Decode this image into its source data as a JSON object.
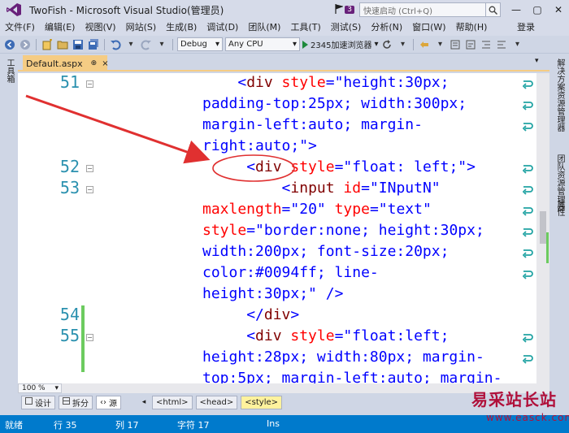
{
  "window": {
    "title": "TwoFish - Microsoft Visual Studio(管理员)",
    "notification_count": "3",
    "quick_launch_placeholder": "快速启动 (Ctrl+Q)",
    "controls": {
      "minimize": "—",
      "restore": "▢",
      "close": "✕"
    }
  },
  "menu": {
    "items": [
      "文件(F)",
      "编辑(E)",
      "视图(V)",
      "网站(S)",
      "生成(B)",
      "调试(D)",
      "团队(M)",
      "工具(T)",
      "测试(S)",
      "分析(N)",
      "窗口(W)",
      "帮助(H)"
    ],
    "login": "登录"
  },
  "toolbar": {
    "configuration": "Debug",
    "platform": "Any CPU",
    "run_target": "2345加速浏览器"
  },
  "left_panel": {
    "toolbox_label": "工具箱"
  },
  "right_panel": {
    "tabs": [
      "解决方案资源管理器",
      "团队资源管理器",
      "属性"
    ]
  },
  "document": {
    "tab_label": "Default.aspx",
    "pin_glyph": "⊕",
    "close_glyph": "×"
  },
  "editor": {
    "line_numbers": [
      {
        "n": "51",
        "row": 0
      },
      {
        "n": "52",
        "row": 4
      },
      {
        "n": "53",
        "row": 5
      },
      {
        "n": "54",
        "row": 11
      },
      {
        "n": "55",
        "row": 12
      }
    ],
    "lines": [
      {
        "indent": "    ",
        "parts": [
          [
            "br",
            "<"
          ],
          [
            "tag",
            "div"
          ],
          [
            "attr",
            " style"
          ],
          [
            "br",
            "="
          ],
          [
            "val",
            "\"height:30px;"
          ]
        ]
      },
      {
        "indent": "",
        "parts": [
          [
            "val",
            "padding-top:25px; width:300px;"
          ]
        ]
      },
      {
        "indent": "",
        "parts": [
          [
            "val",
            "margin-left:auto; margin-"
          ]
        ]
      },
      {
        "indent": "",
        "parts": [
          [
            "val",
            "right:auto;\""
          ],
          [
            "br",
            ">"
          ]
        ]
      },
      {
        "indent": "     ",
        "parts": [
          [
            "br",
            "<"
          ],
          [
            "tag",
            "div"
          ],
          [
            "attr",
            " style"
          ],
          [
            "br",
            "="
          ],
          [
            "val",
            "\"float: left;\""
          ],
          [
            "br",
            ">"
          ]
        ]
      },
      {
        "indent": "         ",
        "parts": [
          [
            "br",
            "<"
          ],
          [
            "tag",
            "input"
          ],
          [
            "attr",
            " id"
          ],
          [
            "br",
            "="
          ],
          [
            "val",
            "\"INputN\""
          ]
        ]
      },
      {
        "indent": "",
        "parts": [
          [
            "attr",
            "maxlength"
          ],
          [
            "br",
            "="
          ],
          [
            "val",
            "\"20\""
          ],
          [
            "attr",
            " type"
          ],
          [
            "br",
            "="
          ],
          [
            "val",
            "\"text\""
          ]
        ]
      },
      {
        "indent": "",
        "parts": [
          [
            "attr",
            "style"
          ],
          [
            "br",
            "="
          ],
          [
            "val",
            "\"border:none; height:30px;"
          ]
        ]
      },
      {
        "indent": "",
        "parts": [
          [
            "val",
            "width:200px; font-size:20px;"
          ]
        ]
      },
      {
        "indent": "",
        "parts": [
          [
            "val",
            "color:#0094ff; line-"
          ]
        ]
      },
      {
        "indent": "",
        "parts": [
          [
            "val",
            "height:30px;\""
          ],
          [
            "br",
            " />"
          ]
        ]
      },
      {
        "indent": "     ",
        "parts": [
          [
            "br",
            "</"
          ],
          [
            "tag",
            "div"
          ],
          [
            "br",
            ">"
          ]
        ]
      },
      {
        "indent": "     ",
        "parts": [
          [
            "br",
            "<"
          ],
          [
            "tag",
            "div"
          ],
          [
            "attr",
            " style"
          ],
          [
            "br",
            "="
          ],
          [
            "val",
            "\"float:left;"
          ]
        ]
      },
      {
        "indent": "",
        "parts": [
          [
            "val",
            "height:28px; width:80px; margin-"
          ]
        ]
      },
      {
        "indent": "",
        "parts": [
          [
            "val",
            "top:5px; margin-left:auto; margin-"
          ]
        ]
      }
    ],
    "zoom": "100 %"
  },
  "view_bar": {
    "design": "设计",
    "split": "拆分",
    "source": "源",
    "breadcrumbs": [
      "<html>",
      "<head>",
      "<style>"
    ]
  },
  "status": {
    "ready": "就绪",
    "row": "行 35",
    "col": "列 17",
    "char": "字符 17",
    "mode": "Ins"
  },
  "watermark": {
    "title": "易采站长站",
    "url": "www.easck.com"
  },
  "colors": {
    "accent": "#007acc",
    "tab_active": "#f5cc84",
    "annotation": "#e03030",
    "line_number": "#2b91af"
  }
}
